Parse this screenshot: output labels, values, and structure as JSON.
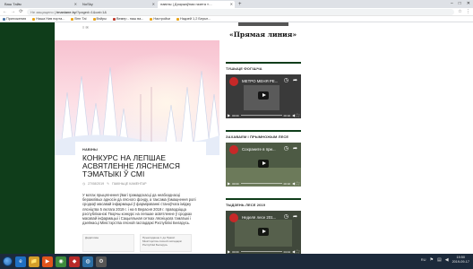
{
  "browser": {
    "tabs": [
      {
        "label": "Ваш Тайм",
        "active": false
      },
      {
        "label": "NoSky",
        "active": false
      },
      {
        "label": "навіны | Дзяржаўная газета «...",
        "active": true
      }
    ],
    "new_tab": "+",
    "window_controls": [
      "–",
      "□",
      "✕"
    ],
    "address": {
      "security": "Не защищено",
      "host": "tmaniane.by",
      "path": "/?paged=1&cat=1&"
    },
    "bookmarks": [
      {
        "label": "Приложения",
        "color": "blue"
      },
      {
        "label": "Наша Нив порта...",
        "color": "orange"
      },
      {
        "label": "Bmr Таi",
        "color": "orange"
      },
      {
        "label": "Вэйры",
        "color": "orange"
      },
      {
        "label": "Вемер - наш ва...",
        "color": "red"
      },
      {
        "label": "Настройки",
        "color": "orange"
      },
      {
        "label": "Надзей 1,2 Берьн...",
        "color": "orange"
      }
    ]
  },
  "page": {
    "crumb": "≡ ✉",
    "article": {
      "category": "НАВІНЫ",
      "title": "КОНКУРС НА ЛЕПШАЕ АСВЯТЛЕННЕ ЛЯСНЕМСЯ ТЭМАТЫКІ Ў СМІ",
      "date": "27/08/2019",
      "comment": "ПАКІНЬЦЕ КАМЕНТАР",
      "body": "У мэтах прыцягнення ўвагі грамадскасці да неабходнасці беражлівых адносін да лясного фонду, а таксама ўзмацнення ролі сродкаў масавай інфармацыі ў фарміраванні станоўчага іміджу лясніцтва 5 лютага 2019 г. і на 6 Верасня 2019 г. праводзіцца рэспубліканскі Творчы конкурс на лепшае асвятленне ў сродках масавай інфармацыі і Сацыяльная сетках лясніцкага тэматыкі і дзейнасці Міністэрства лясной гаспадаркі Рэспублікі Беларусь.",
      "thumb_left": "Дадатковы",
      "thumb_right": "Прыкладанне 1 да Правіл Міністэрства лясной гаспадаркі Рэспублікі Беларусь"
    }
  },
  "sidebar": {
    "logo": "«Прямая линия»",
    "widgets": [
      {
        "title": "ТУШЫЦЕ ФОГІШЧА",
        "video_title": "МЕТРО МЕНЯ РЕ...",
        "time": "00:00",
        "duration": "00:32"
      },
      {
        "title": "ЗАХАВАЕМ І ПРЫМНОЖЫМ ЛЕСЕ",
        "video_title": "Сохраните в при...",
        "time": "00:00",
        "duration": "00:32"
      },
      {
        "title": "ТЫДЗЕНЬ ЛЕСЕ 2019",
        "video_title": "Неделя лесе 201...",
        "time": "00:00",
        "duration": "04:44"
      }
    ]
  },
  "taskbar": {
    "apps": [
      "e",
      "📁",
      "▶",
      "◉",
      "◆",
      "◍",
      "⚙"
    ],
    "lang": "RU",
    "time": "15:50",
    "date": "2019-09-17"
  }
}
